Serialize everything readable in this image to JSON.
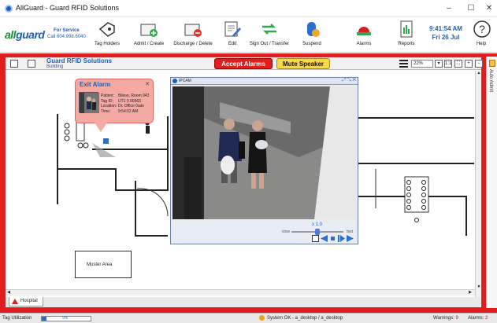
{
  "window": {
    "title": "AllGuard - Guard RFID Solutions",
    "controls": [
      "–",
      "☐",
      "✕"
    ]
  },
  "toolbar": {
    "logo_all": "all",
    "logo_guard": "guard",
    "service_line1": "For Service",
    "service_line2": "Call 604.998.6040",
    "buttons": [
      {
        "label": "Tag Holders",
        "icon": "tag-holders-icon"
      },
      {
        "label": "Admit / Create",
        "icon": "admit-create-icon"
      },
      {
        "label": "Discharge / Delete",
        "icon": "discharge-delete-icon"
      },
      {
        "label": "Edit",
        "icon": "edit-icon"
      },
      {
        "label": "Sign Out / Transfer",
        "icon": "sign-out-transfer-icon"
      },
      {
        "label": "Suspend",
        "icon": "suspend-icon"
      },
      {
        "label": "Alarms",
        "icon": "alarms-icon"
      },
      {
        "label": "Reports",
        "icon": "reports-icon"
      },
      {
        "label": "Help",
        "icon": "help-icon"
      }
    ],
    "time": "9:41:54 AM",
    "date": "Fri 26 Jul"
  },
  "floor": {
    "name": "Guard RFID Solutions",
    "sub": "Building",
    "accept_label": "Accept Alarms",
    "mute_label": "Mute Speaker",
    "zoom": "22%",
    "ratio_label": "1:1"
  },
  "map": {
    "muster_label": "Muster Area"
  },
  "alarm_popup": {
    "title": "Exit Alarm",
    "rows": [
      {
        "k": "Patient:",
        "v": "Bilson, Room 943"
      },
      {
        "k": "Tag ID:",
        "v": "UT1 0 00563"
      },
      {
        "k": "Location:",
        "v": "Dr. Office Gate"
      },
      {
        "k": "Time:",
        "v": "9:54:02 AM"
      }
    ]
  },
  "camera": {
    "title": "IPCAM",
    "speed": "x 1.0",
    "slow": "slow",
    "fast": "fast"
  },
  "side": {
    "auto_admit": "Auto Admit"
  },
  "tabs": [
    {
      "label": "Hospital"
    }
  ],
  "status": {
    "tag_util_label": "Tag Utilization",
    "tag_util_pct": "9%",
    "tag_util_value": 0.09,
    "system": "System OK - a_desktop / a_desktop",
    "warnings_label": "Warnings:",
    "warnings_count": "9",
    "alarms_label": "Alarms:",
    "alarms_count": "2"
  },
  "colors": {
    "accent": "#1f5fb0",
    "alarm_red": "#e11d1d",
    "mute_yellow": "#f7d84a",
    "popup_pink": "#f4a9a3"
  }
}
